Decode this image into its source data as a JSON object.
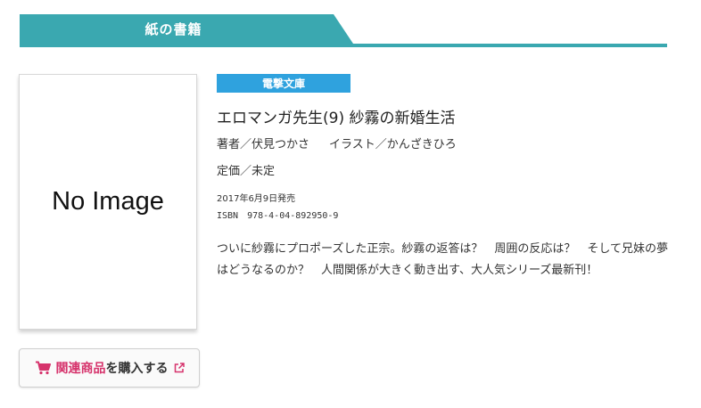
{
  "section": {
    "title": "紙の書籍"
  },
  "cover": {
    "placeholder": "No Image"
  },
  "buy_button": {
    "related_label": "関連商品",
    "suffix_label": "を購入する",
    "icon": "cart-icon",
    "external_icon": "external-link-icon"
  },
  "book": {
    "label": "電撃文庫",
    "title": "エロマンガ先生(9) 紗霧の新婚生活",
    "author": "著者／伏見つかさ",
    "illustrator": "イラスト／かんざきひろ",
    "price": "定価／未定",
    "release_date": "2017年6月9日発売",
    "isbn": "ISBN　978-4-04-892950-9",
    "description": "ついに紗霧にプロポーズした正宗。紗霧の返答は？　周囲の反応は？　そして兄妹の夢はどうなるのか？　人間関係が大きく動き出す、大人気シリーズ最新刊！"
  },
  "colors": {
    "header_teal": "#3aa8b0",
    "badge_blue": "#2fa2de",
    "cart_pink": "#d6336c"
  }
}
